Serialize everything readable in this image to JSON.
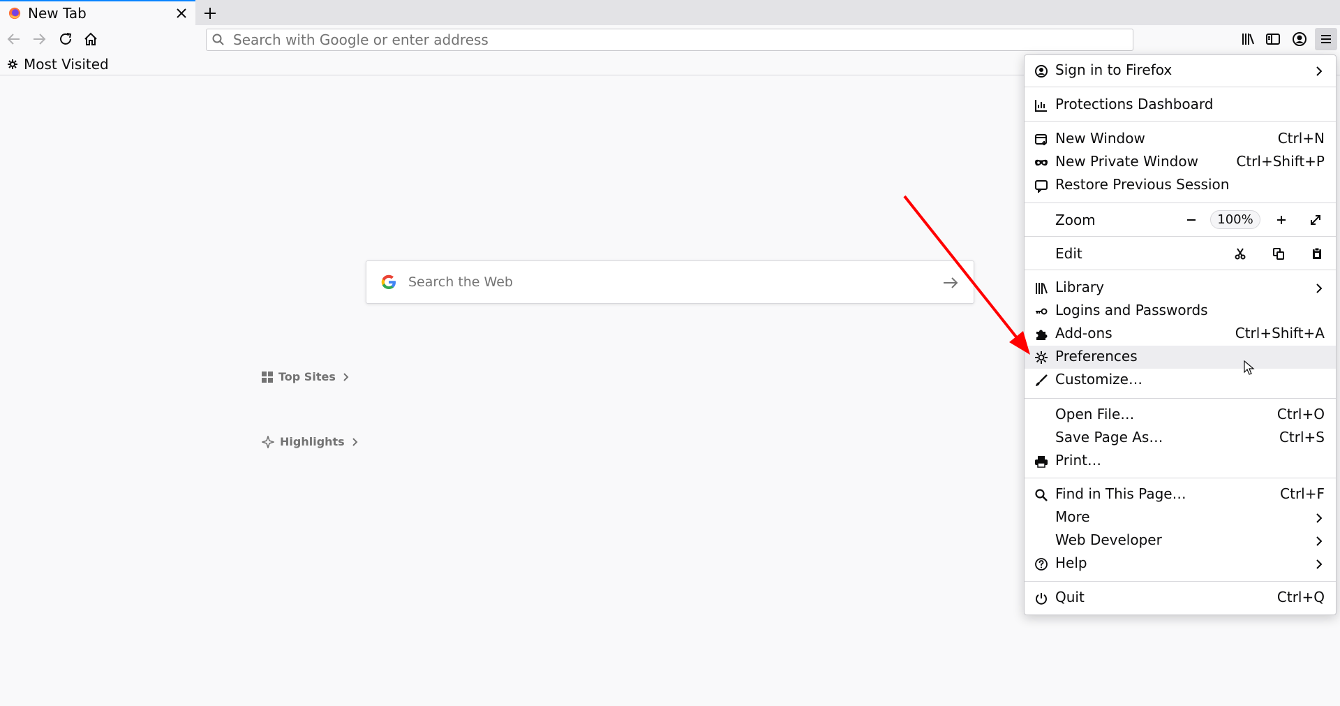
{
  "tab": {
    "title": "New Tab"
  },
  "urlbar": {
    "placeholder": "Search with Google or enter address"
  },
  "bookmarks": {
    "most_visited": "Most Visited"
  },
  "content": {
    "search_placeholder": "Search the Web",
    "top_sites": "Top Sites",
    "highlights": "Highlights"
  },
  "menu": {
    "sign_in": "Sign in to Firefox",
    "protections": "Protections Dashboard",
    "new_window": {
      "label": "New Window",
      "shortcut": "Ctrl+N"
    },
    "new_private": {
      "label": "New Private Window",
      "shortcut": "Ctrl+Shift+P"
    },
    "restore": "Restore Previous Session",
    "zoom": {
      "label": "Zoom",
      "value": "100%"
    },
    "edit": "Edit",
    "library": "Library",
    "logins": "Logins and Passwords",
    "addons": {
      "label": "Add-ons",
      "shortcut": "Ctrl+Shift+A"
    },
    "preferences": "Preferences",
    "customize": "Customize…",
    "open_file": {
      "label": "Open File…",
      "shortcut": "Ctrl+O"
    },
    "save_page": {
      "label": "Save Page As…",
      "shortcut": "Ctrl+S"
    },
    "print": "Print…",
    "find": {
      "label": "Find in This Page…",
      "shortcut": "Ctrl+F"
    },
    "more": "More",
    "web_developer": "Web Developer",
    "help": "Help",
    "quit": {
      "label": "Quit",
      "shortcut": "Ctrl+Q"
    }
  },
  "colors": {
    "accent": "#0a84ff",
    "annotation": "#ff0000",
    "menu_hover": "#ededf0"
  }
}
